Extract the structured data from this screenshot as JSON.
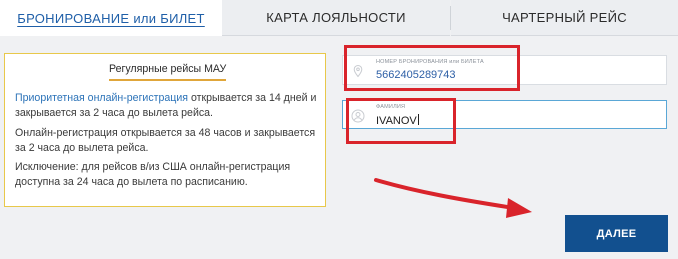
{
  "tabs": [
    {
      "label": "БРОНИРОВАНИЕ или БИЛЕТ",
      "active": true
    },
    {
      "label": "КАРТА ЛОЯЛЬНОСТИ",
      "active": false
    },
    {
      "label": "ЧАРТЕРНЫЙ РЕЙС",
      "active": false
    }
  ],
  "info": {
    "title": "Регулярные рейсы МАУ",
    "p1_highlight": "Приоритетная онлайн-регистрация",
    "p1_rest": " открывается за 14 дней и закрывается за 2 часа до вылета рейса.",
    "p2": "Онлайн-регистрация открывается за 48 часов и закрывается за 2 часа до вылета рейса.",
    "p3": "Исключение: для рейсов в/из США онлайн-регистрация доступна за 24 часа до вылета по расписанию."
  },
  "form": {
    "booking_label": "НОМЕР БРОНИРОВАНИЯ или БИЛЕТА",
    "booking_value": "5662405289743",
    "surname_label": "ФАМИЛИЯ",
    "surname_value": "IVANOV",
    "booking_icon": "pin-icon",
    "surname_icon": "user-icon"
  },
  "next_button": {
    "label": "ДАЛЕЕ"
  },
  "colors": {
    "accent": "#12508f",
    "link": "#2c73b8",
    "highlight_border": "#d9242b",
    "info_border": "#e8c84a"
  }
}
